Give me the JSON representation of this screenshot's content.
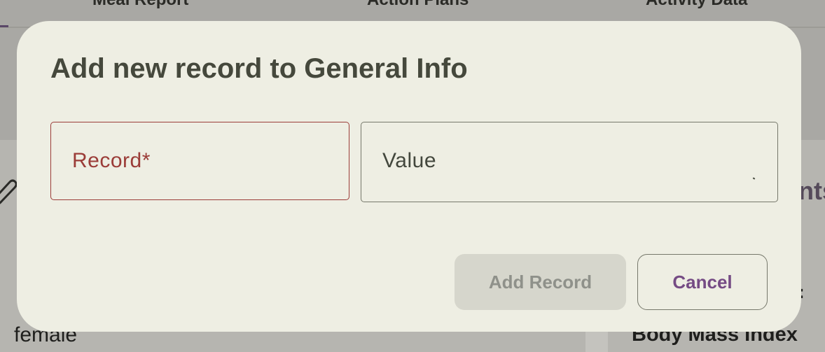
{
  "background": {
    "tabs": [
      "Meal Report",
      "Action Plans",
      "Activity Data"
    ],
    "section_heading_fragment": "nts",
    "label_fragment": ":",
    "gender_value": "female",
    "bmi_label": "Body Mass Index"
  },
  "dialog": {
    "title": "Add new record to General Info",
    "record_field": {
      "label": "Record*",
      "value": ""
    },
    "value_field": {
      "label": "Value",
      "value": ""
    },
    "add_button_label": "Add Record",
    "cancel_button_label": "Cancel"
  },
  "colors": {
    "error": "#9b3c38",
    "accent": "#754b84",
    "dialog_surface": "#eeeee3",
    "scrim": "#a9a8a4"
  }
}
